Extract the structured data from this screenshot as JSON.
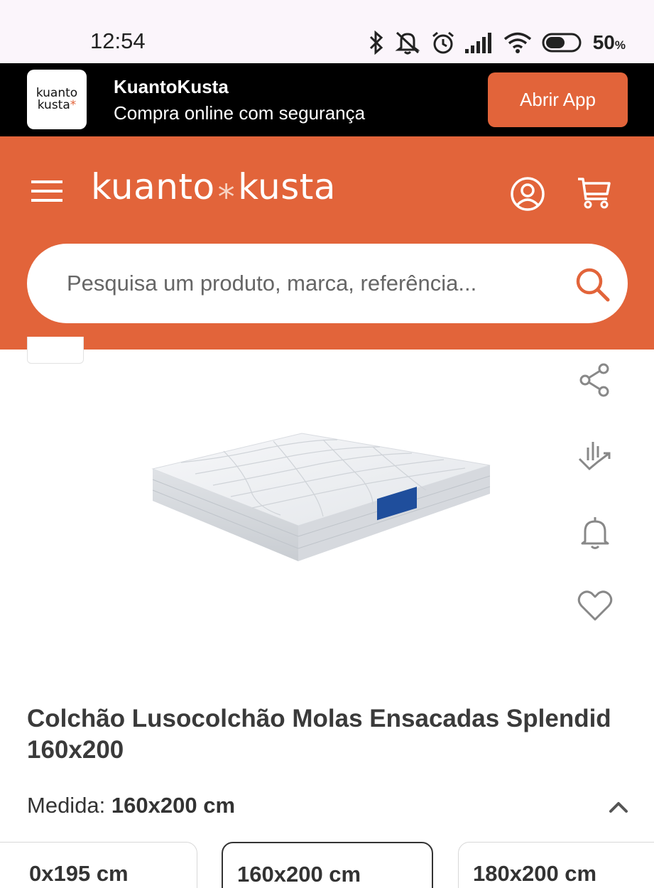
{
  "status_bar": {
    "time": "12:54",
    "battery_percent": "50",
    "battery_unit": "%",
    "icons": [
      "bluetooth-icon",
      "muted-bell-icon",
      "alarm-icon",
      "signal-icon",
      "wifi-icon",
      "battery-icon"
    ]
  },
  "app_banner": {
    "logo_line1": "kuanto",
    "logo_line2": "kusta",
    "title": "KuantoKusta",
    "subtitle": "Compra online com segurança",
    "open_app_label": "Abrir App"
  },
  "header": {
    "brand_part1": "kuanto",
    "brand_star": "*",
    "brand_part2": "kusta",
    "search_placeholder": "Pesquisa um produto, marca, referência..."
  },
  "product": {
    "title": "Colchão Lusocolchão Molas Ensacadas Splendid 160x200",
    "measure_label": "Medida:",
    "measure_value": "160x200 cm",
    "side_actions": [
      "share-icon",
      "price-history-icon",
      "price-alert-icon",
      "favorite-icon"
    ],
    "size_options": [
      {
        "label": "0x195 cm",
        "selected": false
      },
      {
        "label": "160x200 cm",
        "selected": true
      },
      {
        "label": "180x200 cm",
        "selected": false
      }
    ]
  },
  "colors": {
    "brand_orange": "#e2643a",
    "banner_black": "#000000",
    "status_bar_bg": "#fbf5fb"
  }
}
